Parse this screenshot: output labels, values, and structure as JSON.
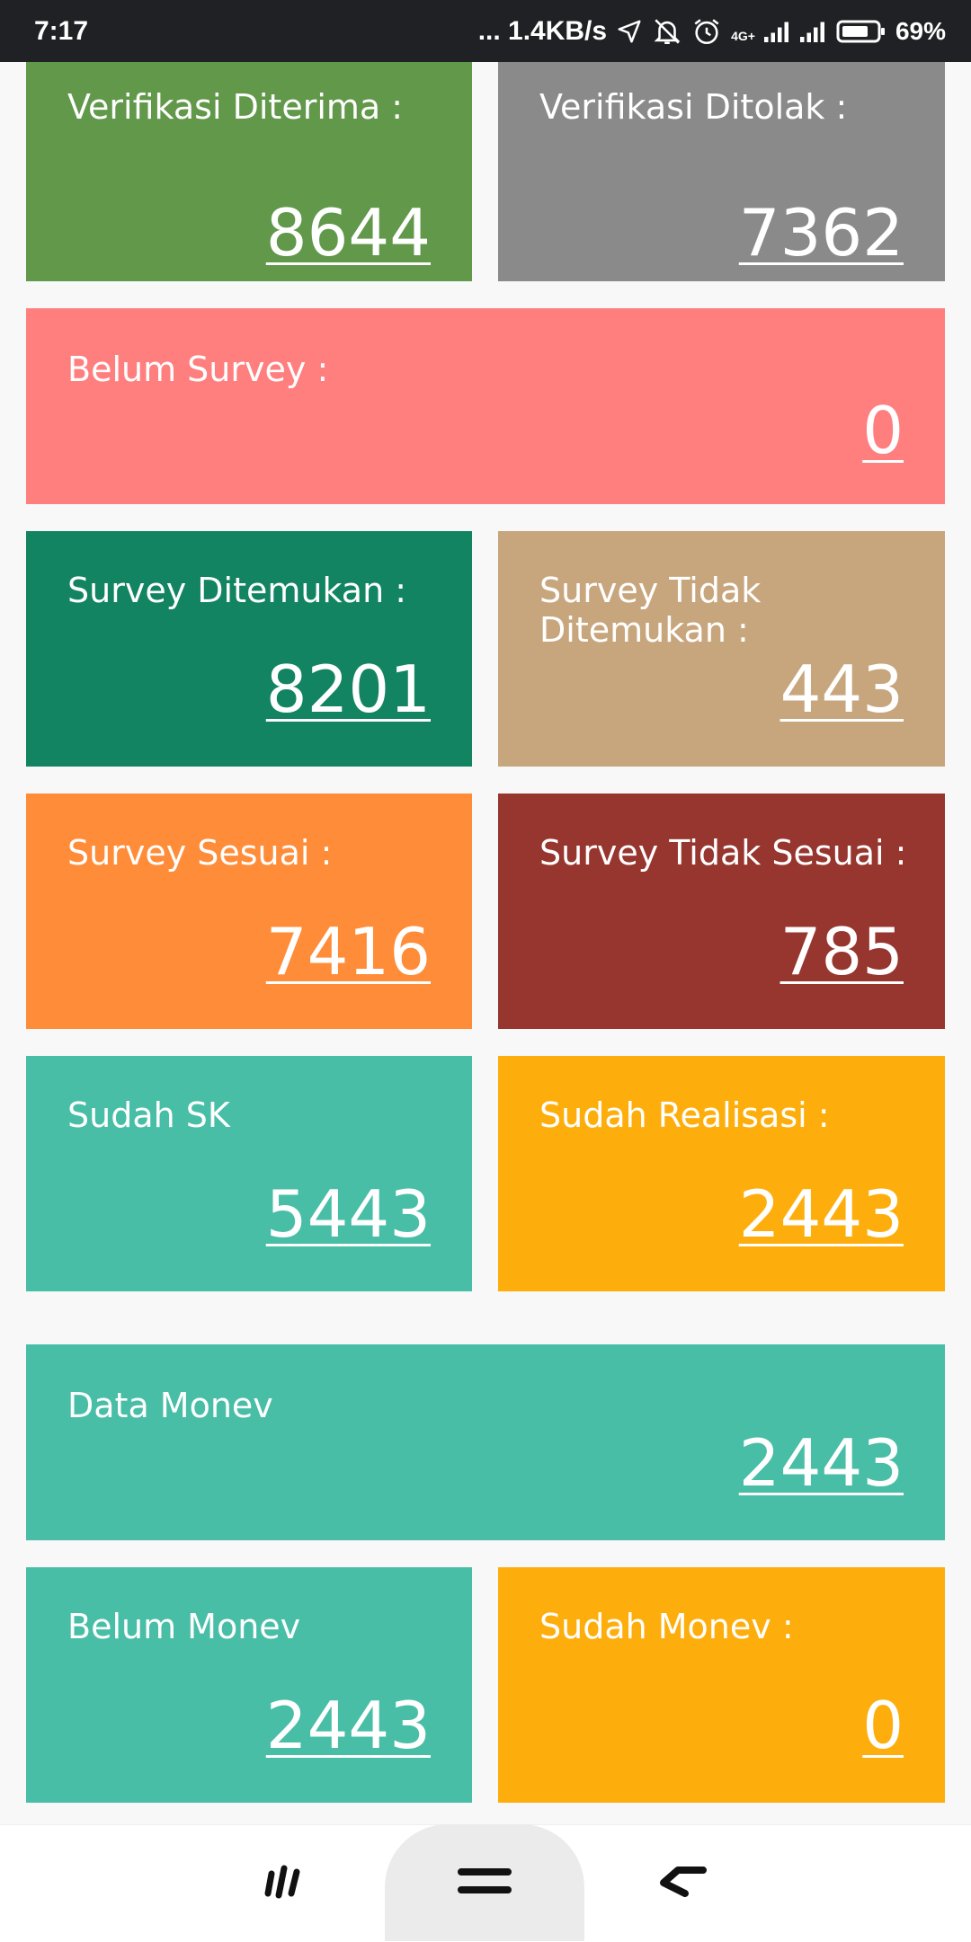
{
  "status_bar": {
    "time": "7:17",
    "network_speed": "... 1.4KB/s",
    "network_type": "4G+",
    "battery": "69%",
    "icons": [
      "location-icon",
      "mute-icon",
      "alarm-icon",
      "signal-icon",
      "signal-icon",
      "battery-icon"
    ]
  },
  "cards": [
    {
      "label": "Verifikasi Diterima :",
      "value": "8644",
      "color": "#61984a"
    },
    {
      "label": "Verifikasi Ditolak :",
      "value": "7362",
      "color": "#8a8a8a"
    },
    {
      "label": "Belum Survey :",
      "value": "0",
      "color": "#ff7f7f"
    },
    {
      "label": "Survey Ditemukan :",
      "value": "8201",
      "color": "#138462"
    },
    {
      "label": "Survey Tidak Ditemukan :",
      "value": "443",
      "color": "#c8a67d"
    },
    {
      "label": "Survey Sesuai :",
      "value": "7416",
      "color": "#ff8c38"
    },
    {
      "label": "Survey Tidak Sesuai :",
      "value": "785",
      "color": "#97352f"
    },
    {
      "label": "Sudah SK",
      "value": "5443",
      "color": "#48bea7"
    },
    {
      "label": "Sudah Realisasi :",
      "value": "2443",
      "color": "#feae0c"
    },
    {
      "label": "Data Monev",
      "value": "2443",
      "color": "#48bea7"
    },
    {
      "label": "Belum Monev",
      "value": "2443",
      "color": "#48bea7"
    },
    {
      "label": "Sudah Monev :",
      "value": "0",
      "color": "#feae0c"
    }
  ],
  "nav_bar": {
    "buttons": [
      "recents-icon",
      "home-icon",
      "back-icon"
    ]
  }
}
